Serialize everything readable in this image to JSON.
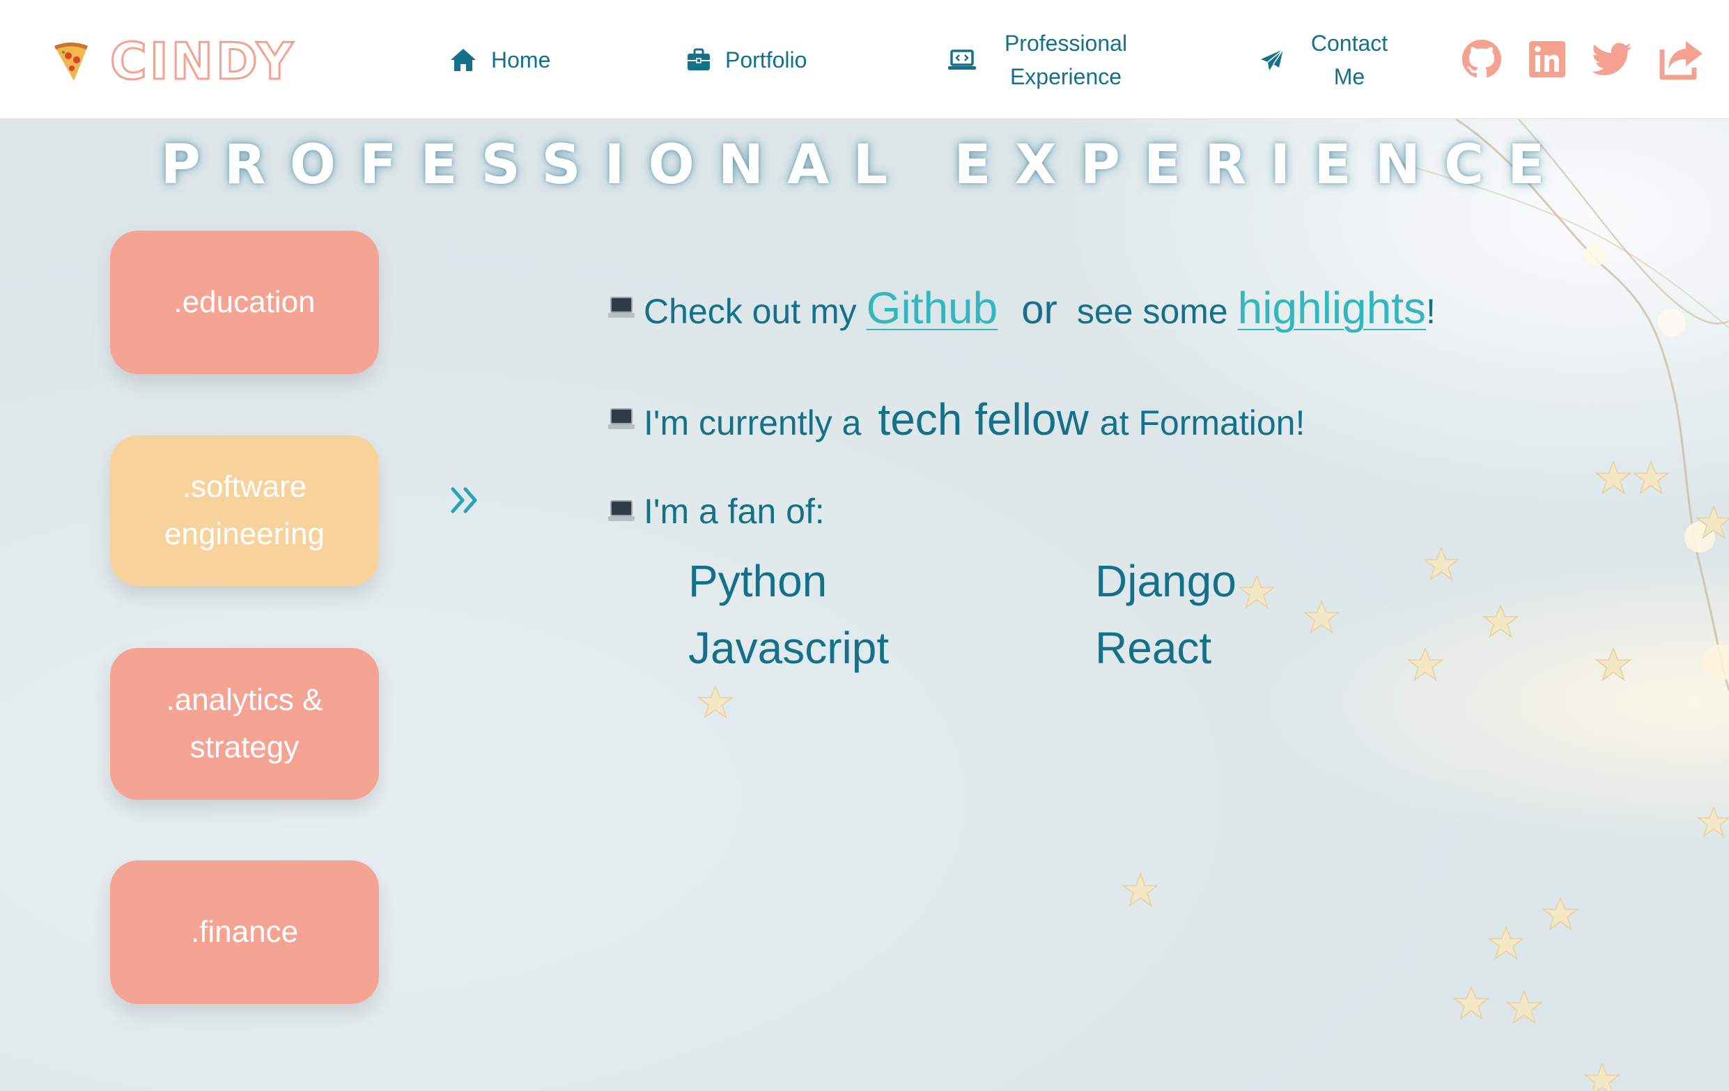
{
  "brand": {
    "name": "CINDY",
    "icon": "pizza-icon"
  },
  "nav": {
    "home": {
      "label": "Home",
      "icon": "home-icon"
    },
    "portfolio": {
      "label": "Portfolio",
      "icon": "briefcase-icon"
    },
    "experience": {
      "label_line1": "Professional",
      "label_line2": "Experience",
      "icon": "laptop-code-icon"
    },
    "contact": {
      "label_line1": "Contact",
      "label_line2": "Me",
      "icon": "paper-plane-icon"
    }
  },
  "social": [
    "github-icon",
    "linkedin-icon",
    "twitter-icon",
    "share-icon"
  ],
  "page_title": "PROFESSIONAL EXPERIENCE",
  "categories": [
    {
      "line1": ".education",
      "line2": ""
    },
    {
      "line1": ".software",
      "line2": "engineering"
    },
    {
      "line1": ".analytics &",
      "line2": "strategy"
    },
    {
      "line1": ".finance",
      "line2": ""
    }
  ],
  "selected_category": ".software engineering",
  "content": {
    "line1": {
      "prefix": "Check out my",
      "github_link": "Github",
      "or": "or",
      "see_some": "see some",
      "highlights_link": "highlights",
      "suffix": "!"
    },
    "line2": {
      "prefix": "I'm currently a",
      "role": "tech fellow",
      "suffix": "at Formation!"
    },
    "line3": {
      "text": "I'm a fan of:"
    },
    "skills": [
      "Python",
      "Django",
      "Javascript",
      "React"
    ]
  },
  "colors": {
    "accent_teal": "#15708a",
    "link_teal": "#33b6bd",
    "salmon": "#f5a494",
    "sand": "#f7d39b"
  }
}
